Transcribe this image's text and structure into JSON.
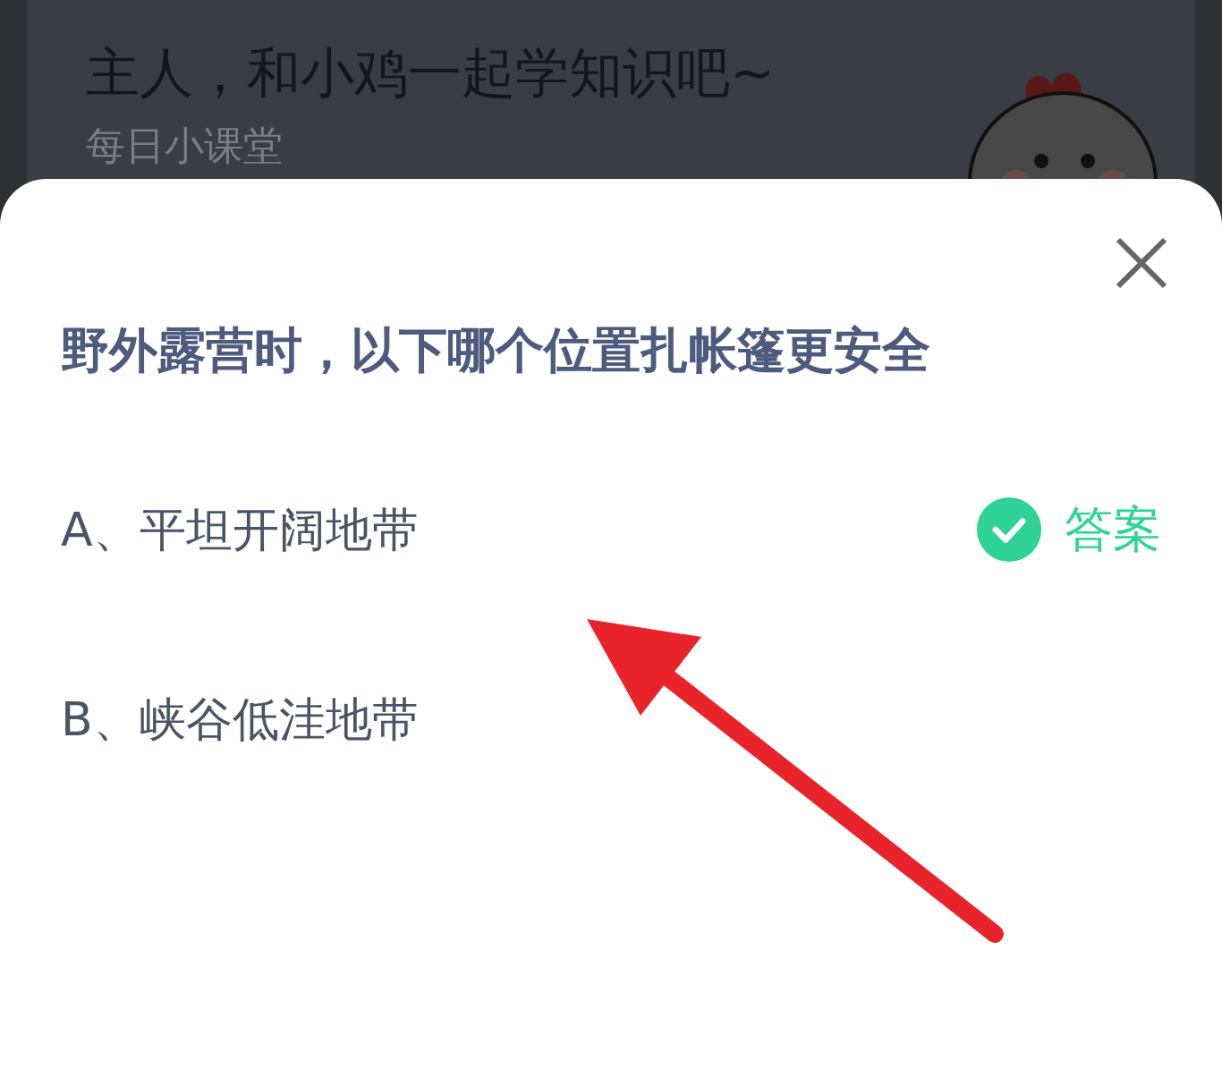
{
  "banner": {
    "title": "主人，和小鸡一起学知识吧~",
    "subtitle": "每日小课堂"
  },
  "dialog": {
    "question": "野外露营时，以下哪个位置扎帐篷更安全",
    "options": [
      {
        "text": "A、平坦开阔地带",
        "correct": true,
        "answer_label": "答案"
      },
      {
        "text": "B、峡谷低洼地带",
        "correct": false
      }
    ]
  }
}
